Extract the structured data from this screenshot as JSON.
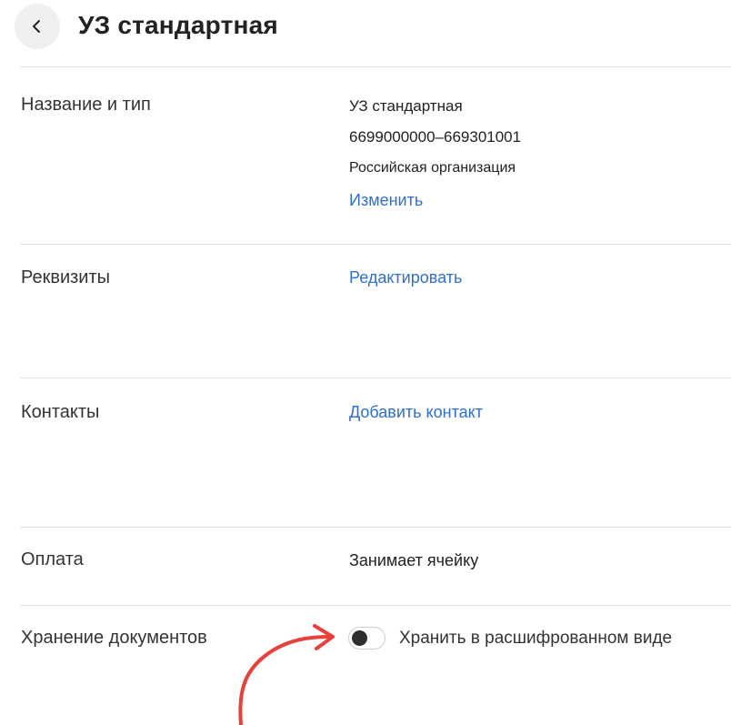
{
  "header": {
    "title": "УЗ стандартная",
    "back_icon": "chevron-left-icon"
  },
  "sections": {
    "name_type": {
      "label": "Название и тип",
      "org_name": "УЗ стандартная",
      "inn_kpp": "6699000000–669301001",
      "org_type": "Российская организация",
      "action": "Изменить"
    },
    "requisites": {
      "label": "Реквизиты",
      "action": "Редактировать"
    },
    "contacts": {
      "label": "Контакты",
      "action": "Добавить контакт"
    },
    "payment": {
      "label": "Оплата",
      "value": "Занимает ячейку"
    },
    "storage": {
      "label": "Хранение документов",
      "toggle_label": "Хранить в расшифрованном виде",
      "toggle_on": false
    }
  },
  "colors": {
    "link": "#2f6fce",
    "annotation_arrow": "#e8403a",
    "divider": "#e3e3e3"
  }
}
